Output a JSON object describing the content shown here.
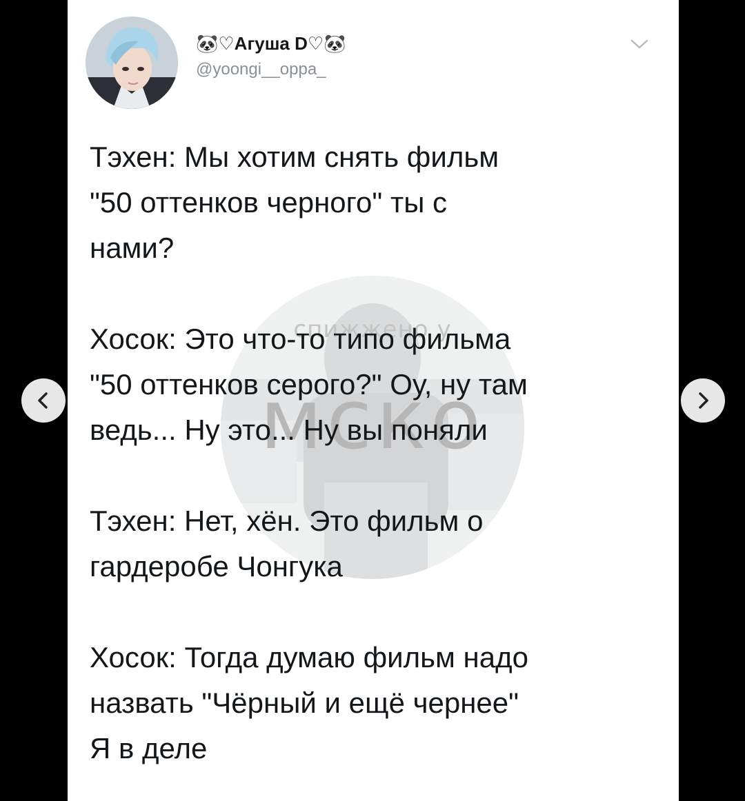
{
  "tweet": {
    "display_name": "🐼♡Агуша D♡🐼",
    "handle": "@yoongi__oppa_",
    "paragraphs": [
      {
        "lines": [
          "Тэхен: Мы хотим снять фильм",
          "\"50 оттенков черного\" ты с",
          "нами?"
        ]
      },
      {
        "lines": [
          "Хосок: Это что-то типо фильма",
          "\"50 оттенков серого?\" Оу, ну там",
          "ведь... Ну это... Ну вы поняли"
        ]
      },
      {
        "lines": [
          "Тэхен: Нет, хён. Это фильм о",
          "гардеробе Чонгука"
        ]
      },
      {
        "lines": [
          "Хосок: Тогда думаю фильм надо",
          "назвать \"Чёрный и ещё чернее\"",
          "Я в деле"
        ]
      }
    ]
  },
  "watermark": {
    "top_text": "спижжено у",
    "main_text": "мско"
  },
  "icons": {
    "menu": "chevron-down-icon",
    "prev": "chevron-left-icon",
    "next": "chevron-right-icon"
  },
  "colors": {
    "page_background": "#000000",
    "card_background": "#ffffff",
    "text": "#14171a",
    "handle": "#8a8f94"
  }
}
